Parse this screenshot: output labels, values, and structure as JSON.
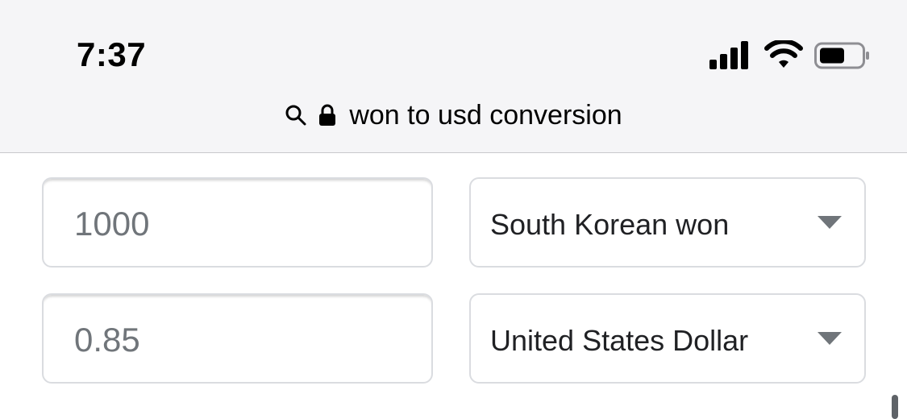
{
  "status_bar": {
    "time": "7:37",
    "icons": [
      "cellular-signal-icon",
      "wifi-icon",
      "battery-icon"
    ]
  },
  "url_bar": {
    "text": "won to usd conversion",
    "icons": [
      "search-icon",
      "lock-icon"
    ]
  },
  "converter": {
    "from_amount": "1000",
    "from_currency": "South Korean won",
    "to_amount": "0.85",
    "to_currency": "United States Dollar"
  },
  "colors": {
    "topbar_bg": "#f5f5f7",
    "field_border": "#dadce0",
    "value_text": "#70757a",
    "select_text": "#202124"
  }
}
